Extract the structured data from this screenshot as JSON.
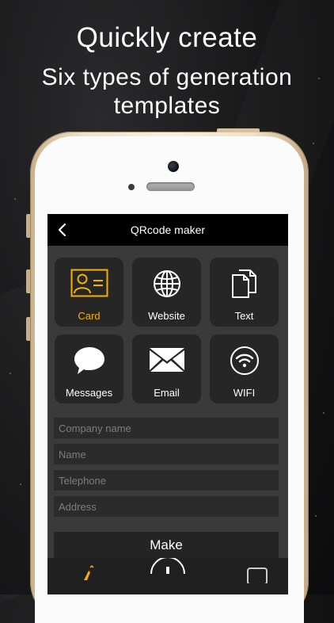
{
  "headline": {
    "line1": "Quickly create",
    "line2": "Six types of generation",
    "line3": "templates"
  },
  "app": {
    "title": "QRcode maker",
    "accent_color": "#f5b000",
    "tiles": [
      {
        "label": "Card",
        "icon": "contact-card-icon",
        "selected": true
      },
      {
        "label": "Website",
        "icon": "globe-icon",
        "selected": false
      },
      {
        "label": "Text",
        "icon": "documents-icon",
        "selected": false
      },
      {
        "label": "Messages",
        "icon": "speech-bubble-icon",
        "selected": false
      },
      {
        "label": "Email",
        "icon": "envelope-icon",
        "selected": false
      },
      {
        "label": "WIFI",
        "icon": "wifi-icon",
        "selected": false
      }
    ],
    "form": {
      "company_placeholder": "Company name",
      "name_placeholder": "Name",
      "telephone_placeholder": "Telephone",
      "address_placeholder": "Address"
    },
    "make_label": "Make"
  }
}
